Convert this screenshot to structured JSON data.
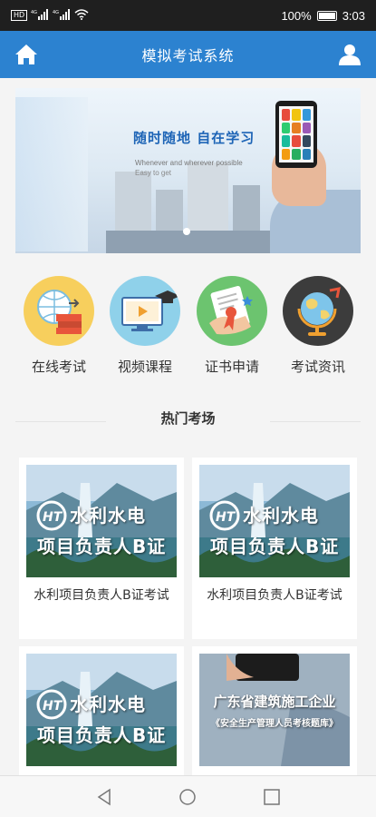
{
  "status": {
    "left_hd": "HD",
    "left_signal1": "4G",
    "left_signal2": "4G",
    "battery": "100%",
    "battery_level": 1.0,
    "time": "3:03"
  },
  "header": {
    "title": "模拟考试系统",
    "home_icon": "home-icon",
    "user_icon": "user-icon"
  },
  "banner": {
    "headline": "随时随地  自在学习",
    "sub1": "Whenever and wherever possible",
    "sub2": "Easy to get"
  },
  "quick_nav": [
    {
      "label": "在线考试",
      "icon": "globe-books-icon",
      "color": "#f7cf5d"
    },
    {
      "label": "视频课程",
      "icon": "video-course-icon",
      "color": "#8fd1ea"
    },
    {
      "label": "证书申请",
      "icon": "certificate-icon",
      "color": "#6cc46f"
    },
    {
      "label": "考试资讯",
      "icon": "globe-news-icon",
      "color": "#3c3c3c"
    }
  ],
  "section": {
    "title": "热门考场"
  },
  "exam_cards": [
    {
      "label": "水利项目负责人B证考试",
      "img_line1": "水利水电",
      "img_line2": "项目负责人B证",
      "logo": "HT"
    },
    {
      "label": "水利项目负责人B证考试",
      "img_line1": "水利水电",
      "img_line2": "项目负责人B证",
      "logo": "HT"
    },
    {
      "label": "",
      "img_line1": "水利水电",
      "img_line2": "项目负责人B证",
      "logo": "HT"
    },
    {
      "label": "",
      "img_line1": "广东省建筑施工企业",
      "img_line2": "《安全生产管理人员考核题库》"
    }
  ],
  "colors": {
    "header_bg": "#2c82d0",
    "status_bg": "#1f1f1f",
    "page_bg": "#f4f4f4"
  }
}
